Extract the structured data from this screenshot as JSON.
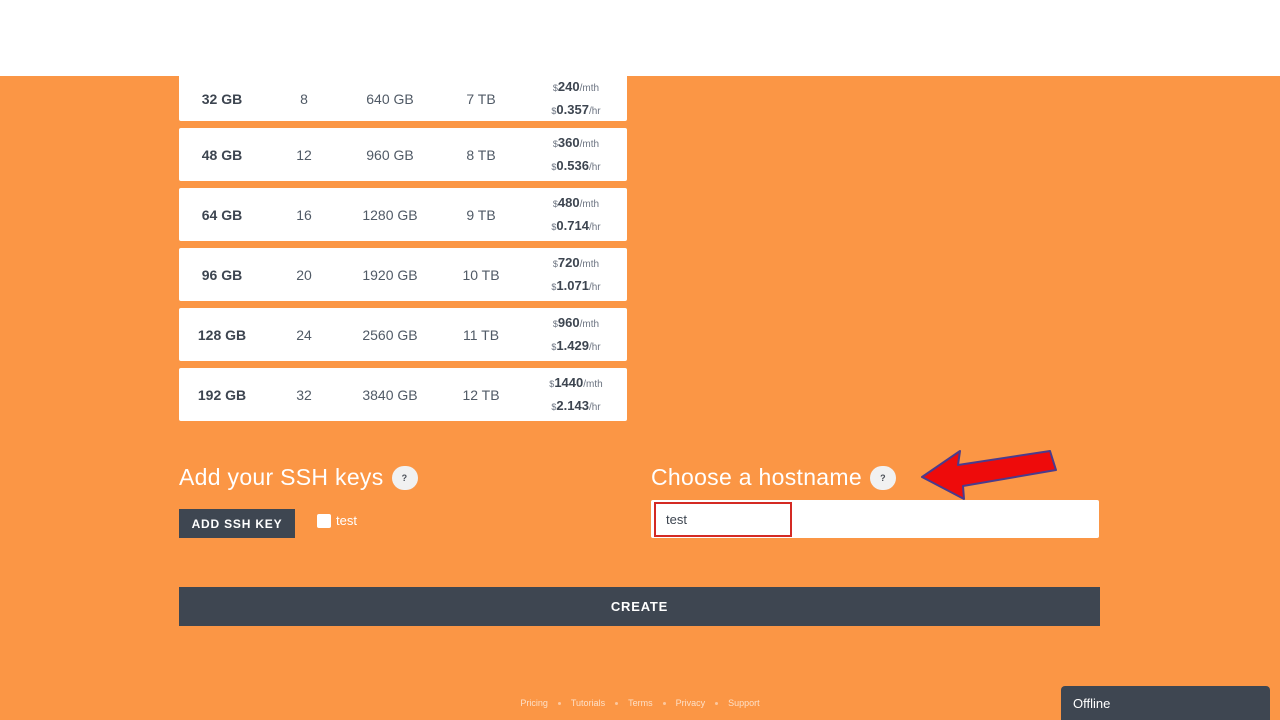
{
  "colors": {
    "accent": "#fb9645",
    "dark": "#3e4651",
    "highlight": "#d42a24"
  },
  "plans": [
    {
      "memory": "32 GB",
      "cpus": "8",
      "ssd": "640 GB",
      "transfer": "7 TB",
      "price_month": "240",
      "price_hour": "0.357"
    },
    {
      "memory": "48 GB",
      "cpus": "12",
      "ssd": "960 GB",
      "transfer": "8 TB",
      "price_month": "360",
      "price_hour": "0.536"
    },
    {
      "memory": "64 GB",
      "cpus": "16",
      "ssd": "1280 GB",
      "transfer": "9 TB",
      "price_month": "480",
      "price_hour": "0.714"
    },
    {
      "memory": "96 GB",
      "cpus": "20",
      "ssd": "1920 GB",
      "transfer": "10 TB",
      "price_month": "720",
      "price_hour": "1.071"
    },
    {
      "memory": "128 GB",
      "cpus": "24",
      "ssd": "2560 GB",
      "transfer": "11 TB",
      "price_month": "960",
      "price_hour": "1.429"
    },
    {
      "memory": "192 GB",
      "cpus": "32",
      "ssd": "3840 GB",
      "transfer": "12 TB",
      "price_month": "1440",
      "price_hour": "2.143"
    }
  ],
  "price_units": {
    "currency": "$",
    "per_month": "/mth",
    "per_hour": "/hr"
  },
  "ssh": {
    "title": "Add your SSH keys",
    "help": "?",
    "add_button": "ADD SSH KEY",
    "key_label": "test"
  },
  "hostname": {
    "title": "Choose a hostname",
    "help": "?",
    "value": "test"
  },
  "create_button": "CREATE",
  "footer": {
    "links": [
      "Pricing",
      "Tutorials",
      "Terms",
      "Privacy",
      "Support"
    ]
  },
  "chat": {
    "status": "Offline"
  },
  "icons": {
    "annotation": "red-arrow-icon",
    "help": "question-mark-icon",
    "checkbox": "checkbox-icon"
  }
}
